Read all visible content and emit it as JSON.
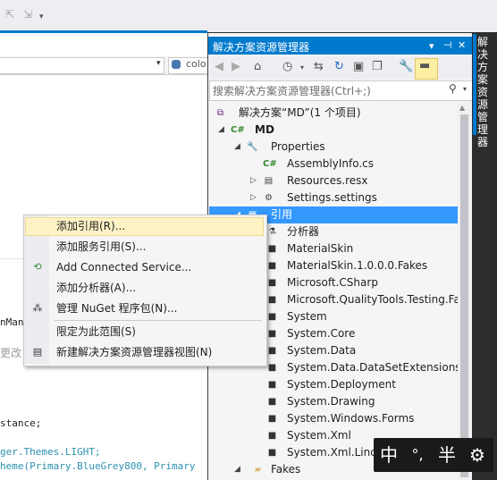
{
  "top_toolbar": {
    "icons": [
      "back-arrow-icon",
      "forward-arrow-icon",
      "overflow-chevron-icon"
    ]
  },
  "editor": {
    "nav_combo_right": "colo",
    "code_lines": [
      "nMan",
      "更改",
      "stance;",
      "ger.Themes.LIGHT;",
      "heme(Primary.BlueGrey800, Primary"
    ]
  },
  "solution_explorer": {
    "title": "解决方案资源管理器",
    "title_buttons": [
      "▾",
      "⊣",
      "✕"
    ],
    "search_placeholder": "搜索解决方案资源管理器(Ctrl+;)",
    "tree": [
      {
        "label": "解决方案“MD”(1 个项目)",
        "icon": "solution-icon"
      },
      {
        "label": "MD",
        "icon": "csharp-project-icon"
      },
      {
        "label": "Properties",
        "icon": "wrench-icon"
      },
      {
        "label": "AssemblyInfo.cs",
        "icon": "csharp-file-icon"
      },
      {
        "label": "Resources.resx",
        "icon": "resx-icon"
      },
      {
        "label": "Settings.settings",
        "icon": "gear-icon"
      },
      {
        "label": "引用",
        "icon": "references-icon"
      },
      {
        "label": "分析器",
        "icon": "analyzer-icon"
      },
      {
        "label": "MaterialSkin",
        "icon": "reference-icon"
      },
      {
        "label": "MaterialSkin.1.0.0.0.Fakes",
        "icon": "reference-icon"
      },
      {
        "label": "Microsoft.CSharp",
        "icon": "reference-icon"
      },
      {
        "label": "Microsoft.QualityTools.Testing.Fa",
        "icon": "reference-icon"
      },
      {
        "label": "System",
        "icon": "reference-icon"
      },
      {
        "label": "System.Core",
        "icon": "reference-icon"
      },
      {
        "label": "System.Data",
        "icon": "reference-icon"
      },
      {
        "label": "System.Data.DataSetExtensions",
        "icon": "reference-icon"
      },
      {
        "label": "System.Deployment",
        "icon": "reference-icon"
      },
      {
        "label": "System.Drawing",
        "icon": "reference-icon"
      },
      {
        "label": "System.Windows.Forms",
        "icon": "reference-icon"
      },
      {
        "label": "System.Xml",
        "icon": "reference-icon"
      },
      {
        "label": "System.Xml.Linq",
        "icon": "reference-icon"
      },
      {
        "label": "Fakes",
        "icon": "folder-icon"
      }
    ]
  },
  "side_tab": {
    "label": "解决方案资源管理器"
  },
  "context_menu": {
    "items": [
      {
        "label": "添加引用(R)...",
        "icon": ""
      },
      {
        "label": "添加服务引用(S)...",
        "icon": ""
      },
      {
        "label": "Add Connected Service...",
        "icon": "connected-service-icon"
      },
      {
        "label": "添加分析器(A)...",
        "icon": ""
      },
      {
        "label": "管理 NuGet 程序包(N)...",
        "icon": "nuget-icon"
      },
      {
        "label": "限定为此范围(S)",
        "icon": ""
      },
      {
        "label": "新建解决方案资源管理器视图(N)",
        "icon": "new-view-icon"
      }
    ]
  },
  "ime_bar": {
    "buttons": [
      "中",
      "°,",
      "半",
      "⚙"
    ]
  },
  "colors": {
    "accent": "#007acc",
    "selection": "#3399ff",
    "menu_highlight": "#fff3c6",
    "dark_chrome": "#2d2d30"
  }
}
